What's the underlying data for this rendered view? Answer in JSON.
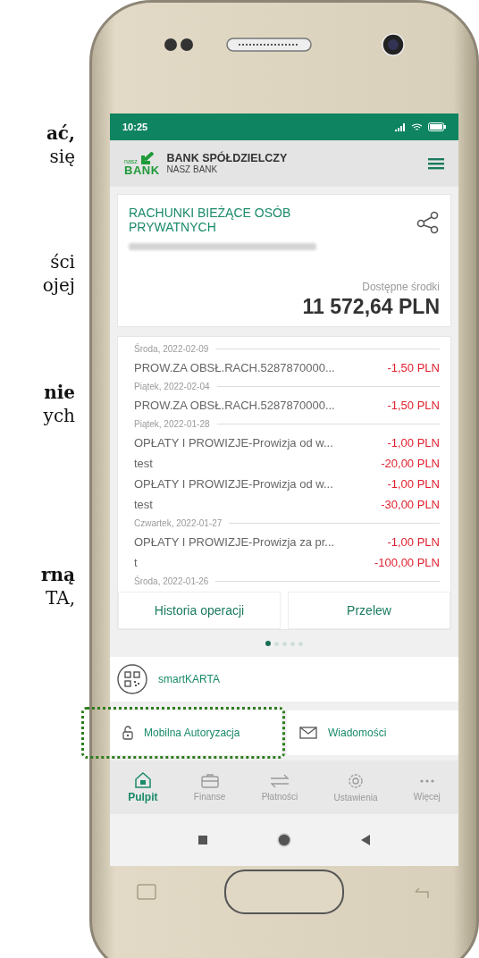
{
  "side_text": [
    {
      "lines": [
        {
          "text": "ać,",
          "bold": true
        },
        {
          "text": "się",
          "bold": false
        }
      ]
    },
    {
      "lines": [
        {
          "text": "ści",
          "bold": false
        },
        {
          "text": "ojej",
          "bold": false
        }
      ]
    },
    {
      "lines": [
        {
          "text": "nie",
          "bold": true
        },
        {
          "text": "ych",
          "bold": false
        }
      ]
    },
    {
      "lines": [
        {
          "text": "rną",
          "bold": true
        },
        {
          "text": "TA,",
          "bold": false
        }
      ]
    }
  ],
  "status_bar": {
    "time": "10:25"
  },
  "header": {
    "logo_small": "nasz",
    "logo_big": "BANK",
    "title": "BANK SPÓŁDZIELCZY",
    "subtitle": "NASZ BANK"
  },
  "account": {
    "name": "RACHUNKI BIEŻĄCE OSÓB PRYWATNYCH",
    "available_label": "Dostępne środki",
    "balance": "11 572,64 PLN"
  },
  "transactions": [
    {
      "date": "Środa, 2022-02-09",
      "items": [
        {
          "title": "PROW.ZA OBSŁ.RACH.5287870000...",
          "amount": "-1,50 PLN"
        }
      ]
    },
    {
      "date": "Piątek, 2022-02-04",
      "items": [
        {
          "title": "PROW.ZA OBSŁ.RACH.5287870000...",
          "amount": "-1,50 PLN"
        }
      ]
    },
    {
      "date": "Piątek, 2022-01-28",
      "items": [
        {
          "title": "OPŁATY I PROWIZJE-Prowizja od w...",
          "amount": "-1,00 PLN"
        },
        {
          "title": "test",
          "amount": "-20,00 PLN"
        },
        {
          "title": "OPŁATY I PROWIZJE-Prowizja od w...",
          "amount": "-1,00 PLN"
        },
        {
          "title": "test",
          "amount": "-30,00 PLN"
        }
      ]
    },
    {
      "date": "Czwartek, 2022-01-27",
      "items": [
        {
          "title": "OPŁATY I PROWIZJE-Prowizja za pr...",
          "amount": "-1,00 PLN"
        },
        {
          "title": "t",
          "amount": "-100,00 PLN"
        }
      ]
    },
    {
      "date": "Środa, 2022-01-26"
    }
  ],
  "card_buttons": [
    "Historia operacji",
    "Przelew"
  ],
  "page_dots": [
    {
      "selected": true
    },
    {
      "selected": false
    },
    {
      "selected": false
    },
    {
      "selected": false
    },
    {
      "selected": false
    }
  ],
  "smartkarta": {
    "label": "smartKARTA"
  },
  "shortcuts": [
    {
      "kind": "lock",
      "label": "Mobilna Autoryzacja",
      "highlighted": true
    },
    {
      "kind": "mail",
      "label": "Wiadomości",
      "highlighted": false
    }
  ],
  "bottom_nav": [
    {
      "kind": "home",
      "label": "Pulpit",
      "selected": true
    },
    {
      "kind": "wallet",
      "label": "Finanse",
      "selected": false
    },
    {
      "kind": "transfer",
      "label": "Płatności",
      "selected": false
    },
    {
      "kind": "gear",
      "label": "Ustawienia",
      "selected": false
    },
    {
      "kind": "more",
      "label": "Więcej",
      "selected": false
    }
  ]
}
